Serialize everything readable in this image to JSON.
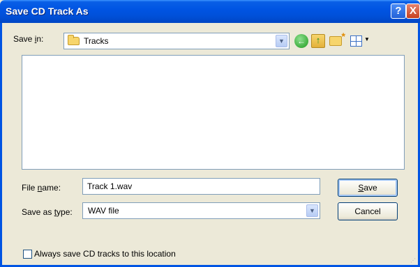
{
  "window": {
    "title": "Save CD Track As",
    "help_glyph": "?",
    "close_glyph": "X"
  },
  "save_in": {
    "label_pre": "Save ",
    "label_accel": "i",
    "label_post": "n:",
    "value": "Tracks"
  },
  "toolbar": {
    "icons": [
      "back-icon",
      "up-folder-icon",
      "new-folder-icon",
      "views-menu-icon"
    ]
  },
  "file_list": {
    "items": []
  },
  "file_name": {
    "label_pre": "File ",
    "label_accel": "n",
    "label_post": "ame:",
    "value": "Track 1.wav"
  },
  "save_as_type": {
    "label_pre": "Save as ",
    "label_accel": "t",
    "label_post": "ype:",
    "value": "WAV file"
  },
  "buttons": {
    "save_accel": "S",
    "save_rest": "ave",
    "cancel": "Cancel"
  },
  "always_save": {
    "label": "Always save CD tracks to this location",
    "checked": false
  },
  "colors": {
    "titlebar": "#0054e3",
    "dialog_bg": "#ece9d8",
    "input_border": "#7f9db9"
  }
}
